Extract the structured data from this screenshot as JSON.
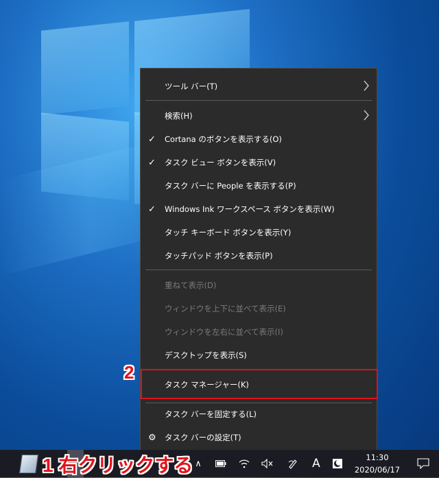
{
  "menu": {
    "items": [
      {
        "label": "ツール バー(T)",
        "checked": false,
        "submenu": true,
        "disabled": false
      },
      {
        "label": "検索(H)",
        "checked": false,
        "submenu": true,
        "disabled": false
      },
      {
        "label": "Cortana のボタンを表示する(O)",
        "checked": true,
        "submenu": false,
        "disabled": false
      },
      {
        "label": "タスク ビュー ボタンを表示(V)",
        "checked": true,
        "submenu": false,
        "disabled": false
      },
      {
        "label": "タスク バーに People を表示する(P)",
        "checked": false,
        "submenu": false,
        "disabled": false
      },
      {
        "label": "Windows Ink ワークスペース ボタンを表示(W)",
        "checked": true,
        "submenu": false,
        "disabled": false
      },
      {
        "label": "タッチ キーボード ボタンを表示(Y)",
        "checked": false,
        "submenu": false,
        "disabled": false
      },
      {
        "label": "タッチパッド ボタンを表示(P)",
        "checked": false,
        "submenu": false,
        "disabled": false
      },
      {
        "label": "重ねて表示(D)",
        "checked": false,
        "submenu": false,
        "disabled": true
      },
      {
        "label": "ウィンドウを上下に並べて表示(E)",
        "checked": false,
        "submenu": false,
        "disabled": true
      },
      {
        "label": "ウィンドウを左右に並べて表示(I)",
        "checked": false,
        "submenu": false,
        "disabled": true
      },
      {
        "label": "デスクトップを表示(S)",
        "checked": false,
        "submenu": false,
        "disabled": false
      },
      {
        "label": "タスク マネージャー(K)",
        "checked": false,
        "submenu": false,
        "disabled": false
      },
      {
        "label": "タスク バーを固定する(L)",
        "checked": false,
        "submenu": false,
        "disabled": false
      },
      {
        "label": "タスク バーの設定(T)",
        "checked": false,
        "submenu": false,
        "disabled": false,
        "icon": "gear-icon"
      }
    ],
    "check_glyph": "✓"
  },
  "annotations": {
    "step1": "1 右クリックする",
    "step2": "2",
    "highlight_color": "#e0101c"
  },
  "taskbar": {
    "time": "11:30",
    "date": "2020/06/17",
    "ime_label": "A",
    "tray_chevron": "∧",
    "icons": [
      "desktop-app-icon",
      "chevron-up-icon",
      "battery-icon",
      "wifi-icon",
      "speaker-muted-icon",
      "pen-workspace-icon",
      "ime-icon",
      "night-light-icon",
      "notification-icon"
    ]
  }
}
